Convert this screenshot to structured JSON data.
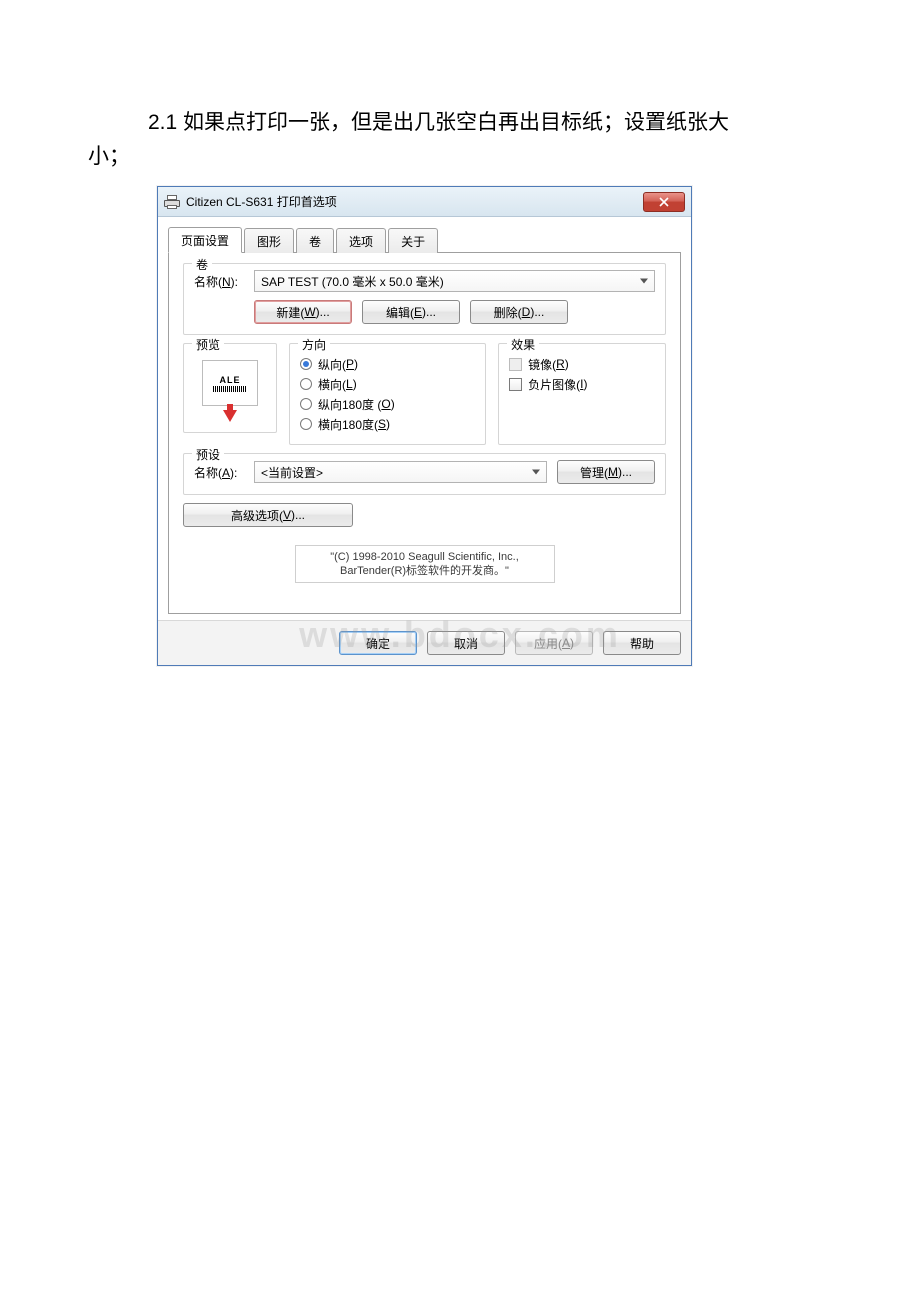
{
  "instruction": {
    "line1_prefix": "2.1 如果点打印一张，但是出几张空白再出目标纸；设置纸张大",
    "line2": "小；"
  },
  "dialog": {
    "title": "Citizen CL-S631 打印首选项",
    "close_icon": "close-icon"
  },
  "tabs": {
    "t0": "页面设置",
    "t1": "图形",
    "t2": "卷",
    "t3": "选项",
    "t4": "关于"
  },
  "roll": {
    "legend": "卷",
    "name_label": "名称(N):",
    "name_value": "SAP TEST (70.0 毫米 x 50.0 毫米)",
    "btn_new": "新建(W)...",
    "btn_edit": "编辑(E)...",
    "btn_delete": "删除(D)..."
  },
  "preview": {
    "legend": "预览",
    "ale": "ALE"
  },
  "direction": {
    "legend": "方向",
    "opt_portrait": "纵向(P)",
    "opt_landscape": "横向(L)",
    "opt_p180": "纵向180度 (O)",
    "opt_l180": "横向180度(S)"
  },
  "effects": {
    "legend": "效果",
    "mirror": "镜像(R)",
    "negative": "负片图像(I)"
  },
  "preset": {
    "legend": "预设",
    "name_label": "名称(A):",
    "value": "<当前设置>",
    "manage": "管理(M)..."
  },
  "advanced": {
    "btn": "高级选项(V)..."
  },
  "copyright": {
    "l1": "\"(C) 1998-2010 Seagull Scientific, Inc.,",
    "l2": "BarTender(R)标签软件的开发商。\""
  },
  "footer": {
    "ok": "确定",
    "cancel": "取消",
    "apply": "应用(A)",
    "help": "帮助"
  },
  "watermark": "www.bdocx.com"
}
